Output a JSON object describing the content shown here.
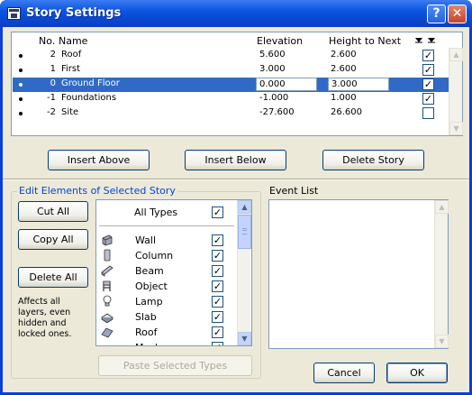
{
  "window": {
    "title": "Story Settings",
    "help_label": "?",
    "close_label": "✕"
  },
  "table": {
    "headers": {
      "no": "No.",
      "name": "Name",
      "elevation": "Elevation",
      "height": "Height to Next"
    },
    "rows": [
      {
        "no": "2",
        "name": "Roof",
        "elevation": "5.600",
        "height": "2.600",
        "checked": true,
        "selected": false
      },
      {
        "no": "1",
        "name": "First",
        "elevation": "3.000",
        "height": "2.600",
        "checked": true,
        "selected": false
      },
      {
        "no": "0",
        "name": "Ground Floor",
        "elevation": "0.000",
        "height": "3.000",
        "checked": true,
        "selected": true
      },
      {
        "no": "-1",
        "name": "Foundations",
        "elevation": "-1.000",
        "height": "1.000",
        "checked": true,
        "selected": false
      },
      {
        "no": "-2",
        "name": "Site",
        "elevation": "-27.600",
        "height": "26.600",
        "checked": false,
        "selected": false
      }
    ]
  },
  "buttons": {
    "insert_above": "Insert Above",
    "insert_below": "Insert Below",
    "delete_story": "Delete Story",
    "cut_all": "Cut All",
    "copy_all": "Copy All",
    "delete_all": "Delete All",
    "paste_selected": "Paste Selected Types",
    "cancel": "Cancel",
    "ok": "OK"
  },
  "edit_group": {
    "title": "Edit Elements of Selected Story",
    "note": "Affects all layers, even hidden and locked ones.",
    "all_types_label": "All Types",
    "types": [
      {
        "label": "Wall",
        "icon": "wall-icon",
        "checked": true
      },
      {
        "label": "Column",
        "icon": "column-icon",
        "checked": true
      },
      {
        "label": "Beam",
        "icon": "beam-icon",
        "checked": true
      },
      {
        "label": "Object",
        "icon": "object-icon",
        "checked": true
      },
      {
        "label": "Lamp",
        "icon": "lamp-icon",
        "checked": true
      },
      {
        "label": "Slab",
        "icon": "slab-icon",
        "checked": true
      },
      {
        "label": "Roof",
        "icon": "roof-icon",
        "checked": true
      },
      {
        "label": "Mesh",
        "icon": "mesh-icon",
        "checked": true
      }
    ]
  },
  "event_list": {
    "title": "Event List"
  }
}
